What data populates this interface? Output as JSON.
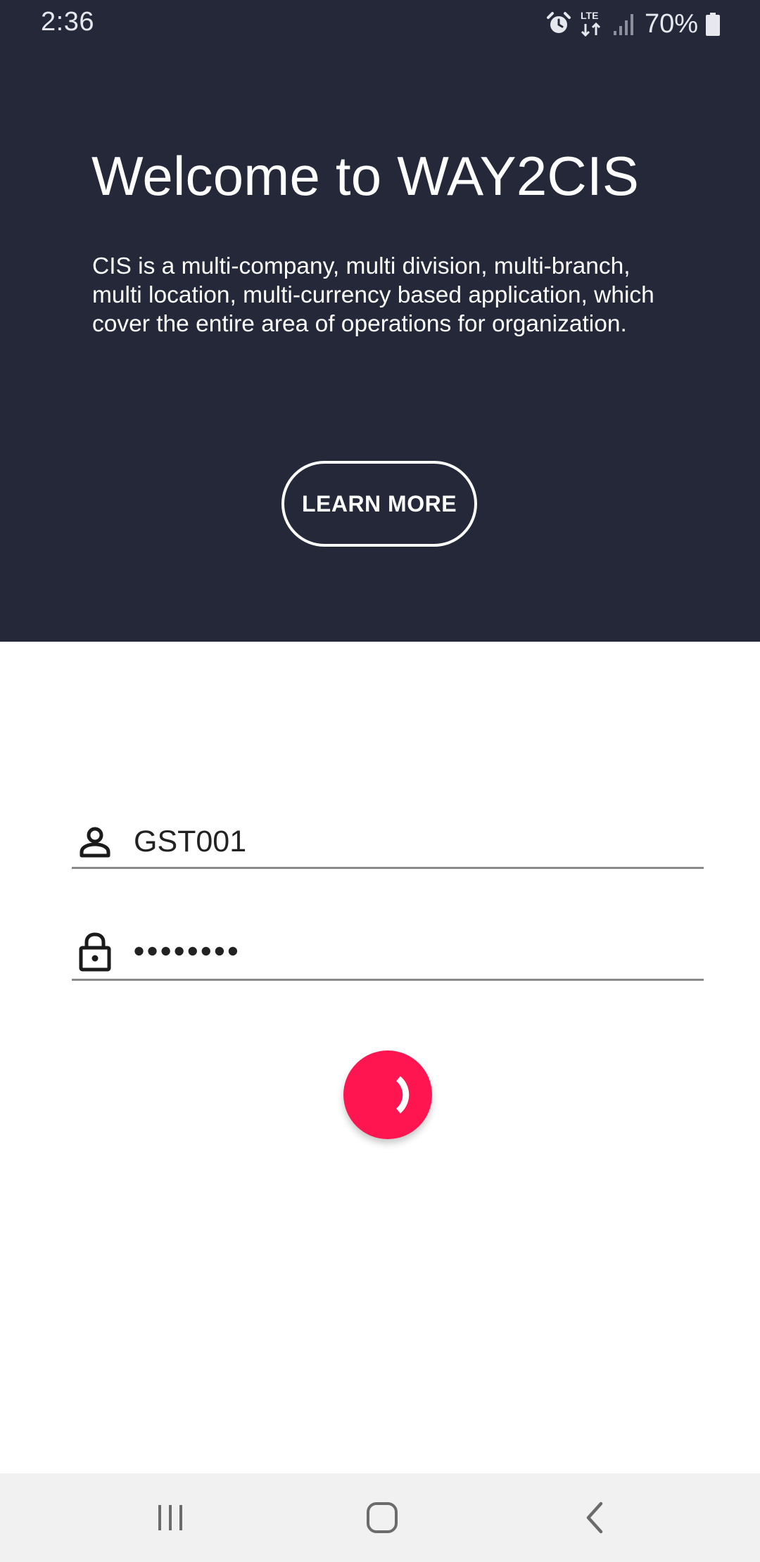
{
  "status_bar": {
    "time": "2:36",
    "network": "LTE",
    "battery": "70%",
    "icons": [
      "alarm-icon",
      "lte-data-icon",
      "signal-icon",
      "battery-icon"
    ]
  },
  "hero": {
    "title": "Welcome to WAY2CIS",
    "description": "CIS is a multi-company, multi division, multi-branch, multi location, multi-currency based application, which cover the entire area of operations for organization.",
    "learn_more_label": "LEARN MORE",
    "background_color": "#242839"
  },
  "login_form": {
    "username": {
      "icon": "person-icon",
      "value": "GST001"
    },
    "password": {
      "icon": "lock-icon",
      "value": "••••••••"
    },
    "submit": {
      "icon": "loading-spinner-icon",
      "color": "#ff1650"
    }
  },
  "nav_bar": {
    "buttons": [
      "recents-icon",
      "home-icon",
      "back-icon"
    ]
  }
}
